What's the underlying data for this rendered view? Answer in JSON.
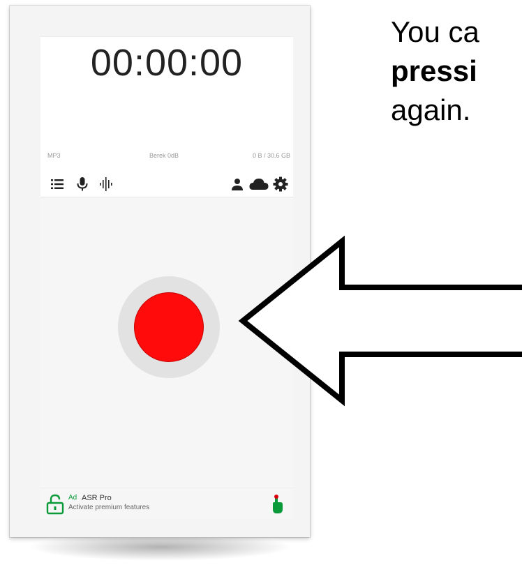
{
  "screen": {
    "timer": "00:00:00",
    "format": "MP3",
    "gain": "Berek 0dB",
    "storage": "0 B / 30.6 GB"
  },
  "toolbar": {
    "icons": [
      "list-icon",
      "mic-icon",
      "waveform-icon",
      "person-icon",
      "cloud-icon",
      "gear-icon"
    ]
  },
  "record_button": {
    "color": "#ff0b0b",
    "ring_color": "#e2e2e2"
  },
  "ad": {
    "tag": "Ad",
    "title": "ASR Pro",
    "subtitle": "Activate premium features",
    "accent": "#0b9a3a"
  },
  "callout": {
    "line1": "You ca",
    "line2": "pressi",
    "line3": "again."
  }
}
